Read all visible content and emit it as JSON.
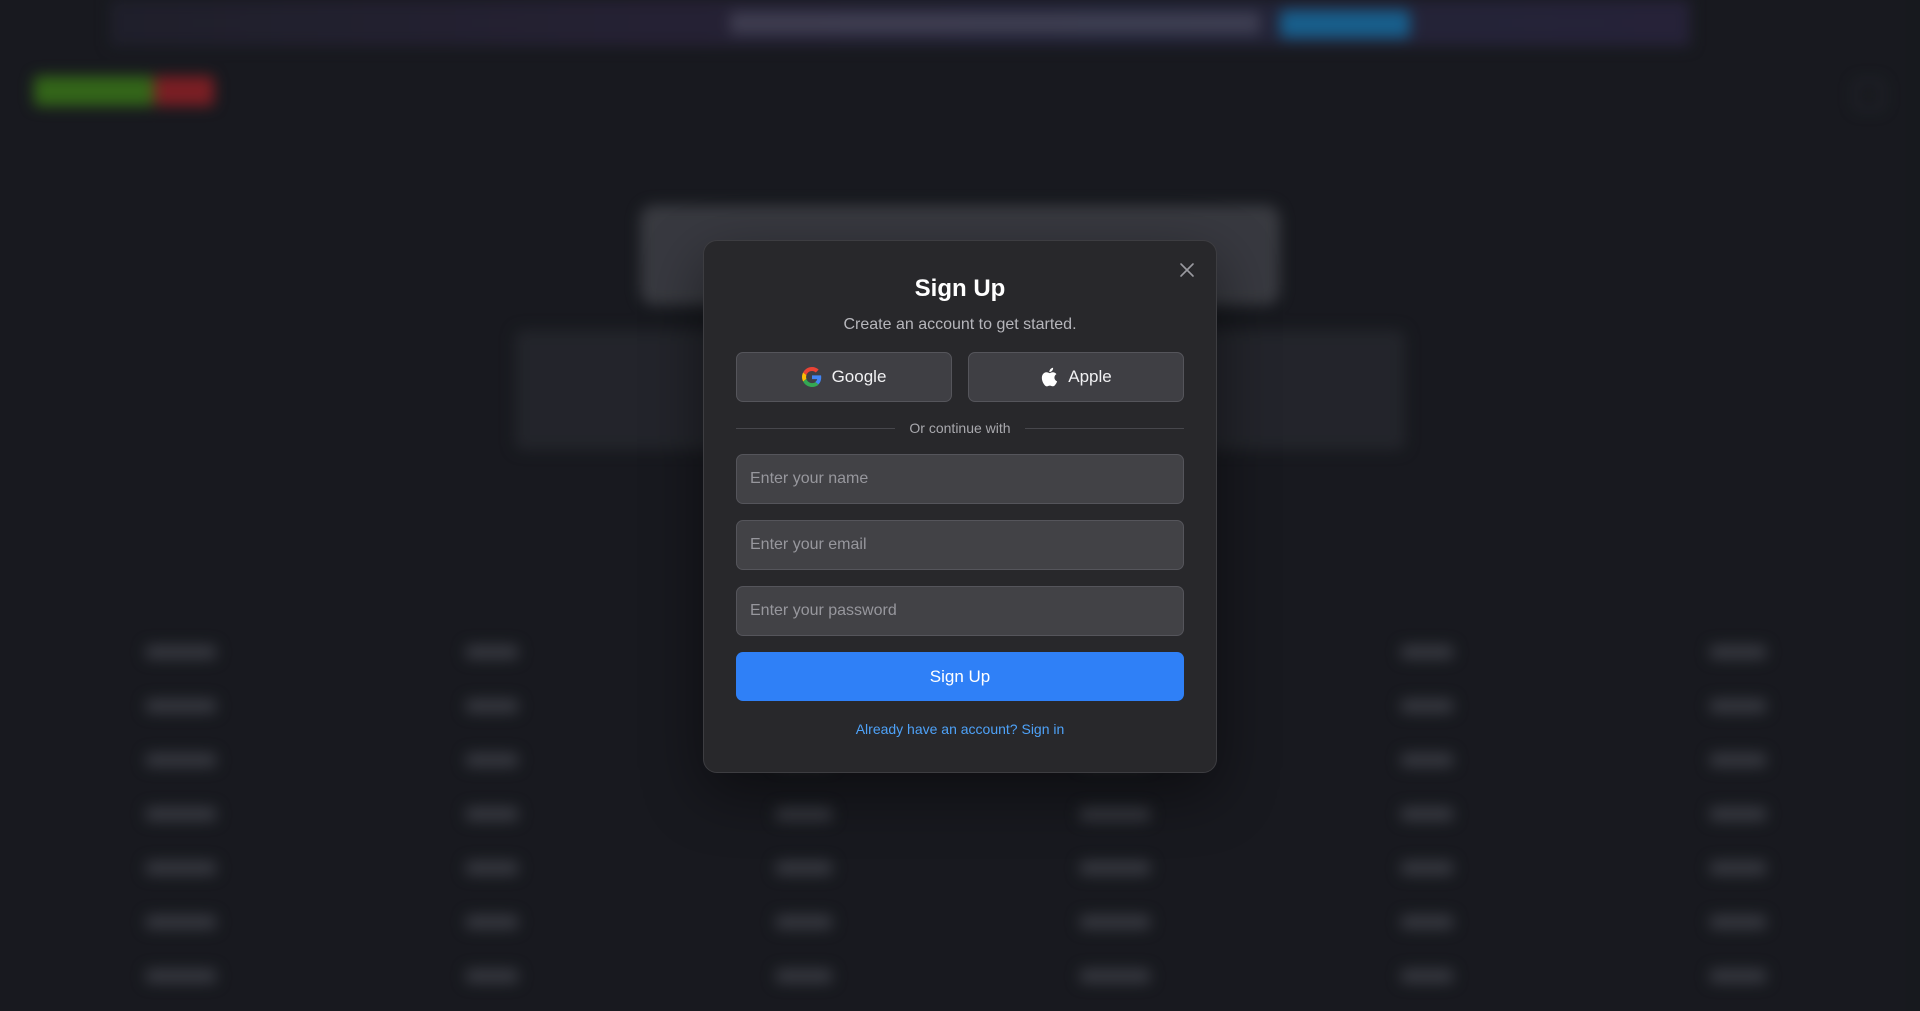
{
  "modal": {
    "title": "Sign Up",
    "subtitle": "Create an account to get started.",
    "google_label": "Google",
    "apple_label": "Apple",
    "divider_text": "Or continue with",
    "name_placeholder": "Enter your name",
    "email_placeholder": "Enter your email",
    "password_placeholder": "Enter your password",
    "submit_label": "Sign Up",
    "signin_link": "Already have an account? Sign in"
  },
  "colors": {
    "page_bg": "#1c1e24",
    "modal_bg": "#28282b",
    "primary": "#2f80f7",
    "link": "#4ea2f8",
    "logo_green": "#4a9d1a",
    "logo_red": "#c1272d",
    "banner_button": "#1c7ab5"
  },
  "icons": {
    "close": "close-icon",
    "google": "google-logo-icon",
    "apple": "apple-logo-icon"
  }
}
